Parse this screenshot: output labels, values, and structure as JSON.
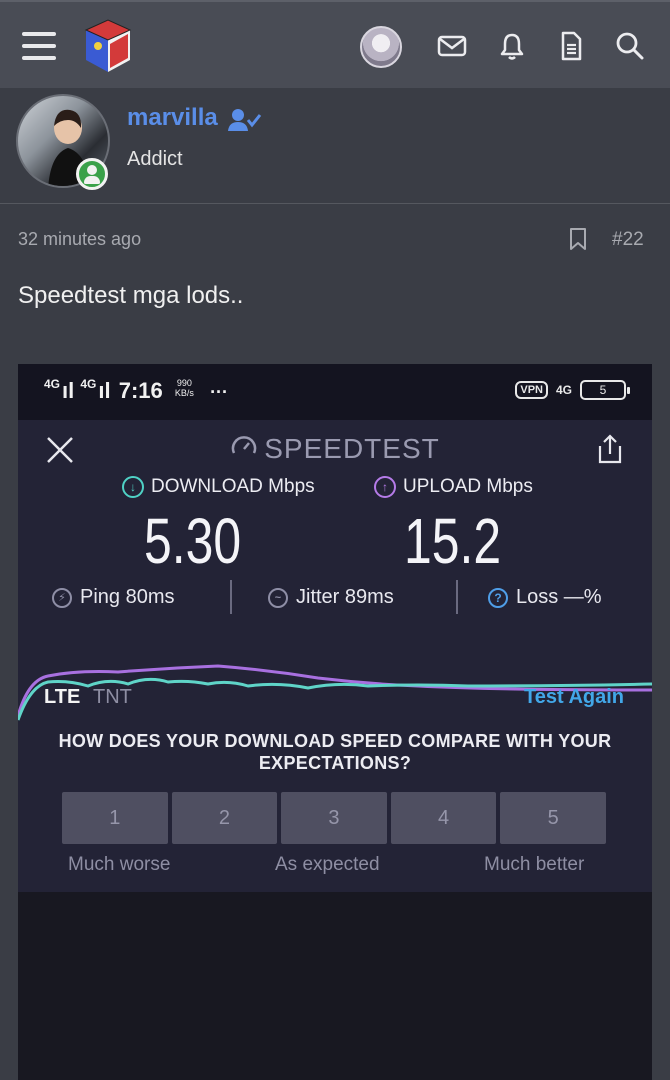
{
  "topbar": {
    "menu_icon": "hamburger-icon",
    "logo_icon": "site-logo-cube",
    "icons": [
      "avatar",
      "mail-icon",
      "bell-icon",
      "document-icon",
      "search-icon"
    ]
  },
  "post": {
    "username": "marvilla",
    "user_title": "Addict",
    "time": "32 minutes ago",
    "post_number": "#22",
    "body": "Speedtest mga lods.."
  },
  "phone": {
    "status": {
      "signal1": "4G",
      "signal2": "4G",
      "time": "7:16",
      "speed_top": "990",
      "speed_unit": "KB/s",
      "dots": "···",
      "vpn": "VPN",
      "net": "4G",
      "battery": "5"
    },
    "speedtest": {
      "title": "SPEEDTEST",
      "download_label": "DOWNLOAD Mbps",
      "upload_label": "UPLOAD Mbps",
      "download_value": "5.30",
      "upload_value": "15.2",
      "ping": "Ping 80ms",
      "jitter": "Jitter 89ms",
      "loss": "Loss —%",
      "network_type": "LTE",
      "carrier": "TNT",
      "test_again": "Test Again",
      "question": "HOW DOES YOUR DOWNLOAD SPEED COMPARE WITH YOUR EXPECTATIONS?",
      "ratings": [
        "1",
        "2",
        "3",
        "4",
        "5"
      ],
      "rating_low": "Much worse",
      "rating_mid": "As expected",
      "rating_high": "Much better"
    }
  },
  "colors": {
    "accent_link": "#5a8ee8",
    "download": "#4fd1c5",
    "upload": "#b57be8",
    "test_again": "#42a7e8"
  }
}
